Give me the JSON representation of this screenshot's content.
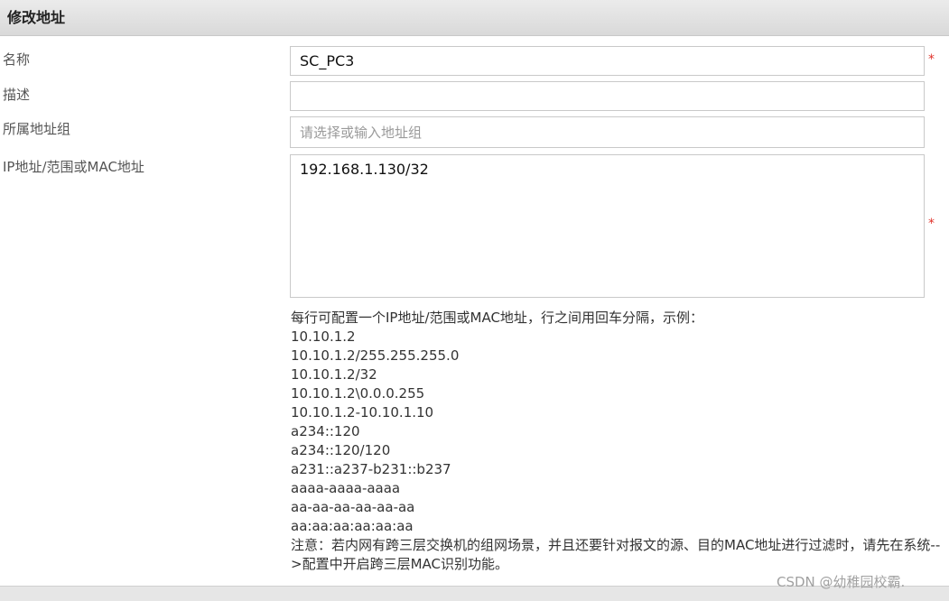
{
  "dialog": {
    "title": "修改地址"
  },
  "form": {
    "name_label": "名称",
    "name_value": "SC_PC3",
    "desc_label": "描述",
    "desc_value": "",
    "group_label": "所属地址组",
    "group_placeholder": "请选择或输入地址组",
    "ip_label": "IP地址/范围或MAC地址",
    "ip_value": "192.168.1.130/32",
    "required_mark": "*"
  },
  "hint": {
    "intro": "每行可配置一个IP地址/范围或MAC地址，行之间用回车分隔，示例：",
    "examples": [
      "10.10.1.2",
      "10.10.1.2/255.255.255.0",
      "10.10.1.2/32",
      "10.10.1.2\\0.0.0.255",
      "10.10.1.2-10.10.1.10",
      "a234::120",
      "a234::120/120",
      "a231::a237-b231::b237",
      "aaaa-aaaa-aaaa",
      "aa-aa-aa-aa-aa-aa",
      "aa:aa:aa:aa:aa:aa"
    ],
    "note": "注意：若内网有跨三层交换机的组网场景，并且还要针对报文的源、目的MAC地址进行过滤时，请先在系统-->配置中开启跨三层MAC识别功能。"
  },
  "watermark": "CSDN @幼稚园校霸.",
  "colors": {
    "required": "#e0322b",
    "border": "#c9c9c9",
    "header": "#dcdcdc"
  }
}
